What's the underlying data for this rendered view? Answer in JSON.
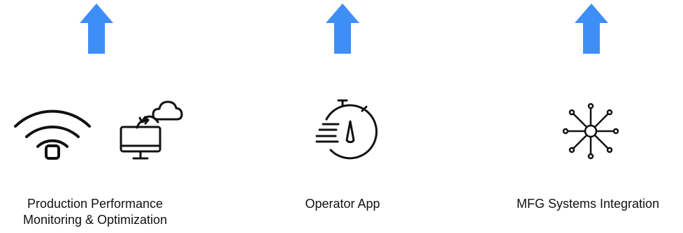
{
  "colors": {
    "arrow": "#3E8EF7",
    "icon": "#111111",
    "text": "#111111"
  },
  "icons": {
    "production": [
      "wifi-icon",
      "monitor-cloud-sync-icon"
    ],
    "operator": "stopwatch-speed-icon",
    "integration": "network-hub-icon"
  },
  "columns": [
    {
      "label_lines": [
        "Production Performance",
        "Monitoring & Optimization"
      ]
    },
    {
      "label_lines": [
        "Operator App"
      ]
    },
    {
      "label_lines": [
        "MFG Systems Integration"
      ]
    }
  ]
}
